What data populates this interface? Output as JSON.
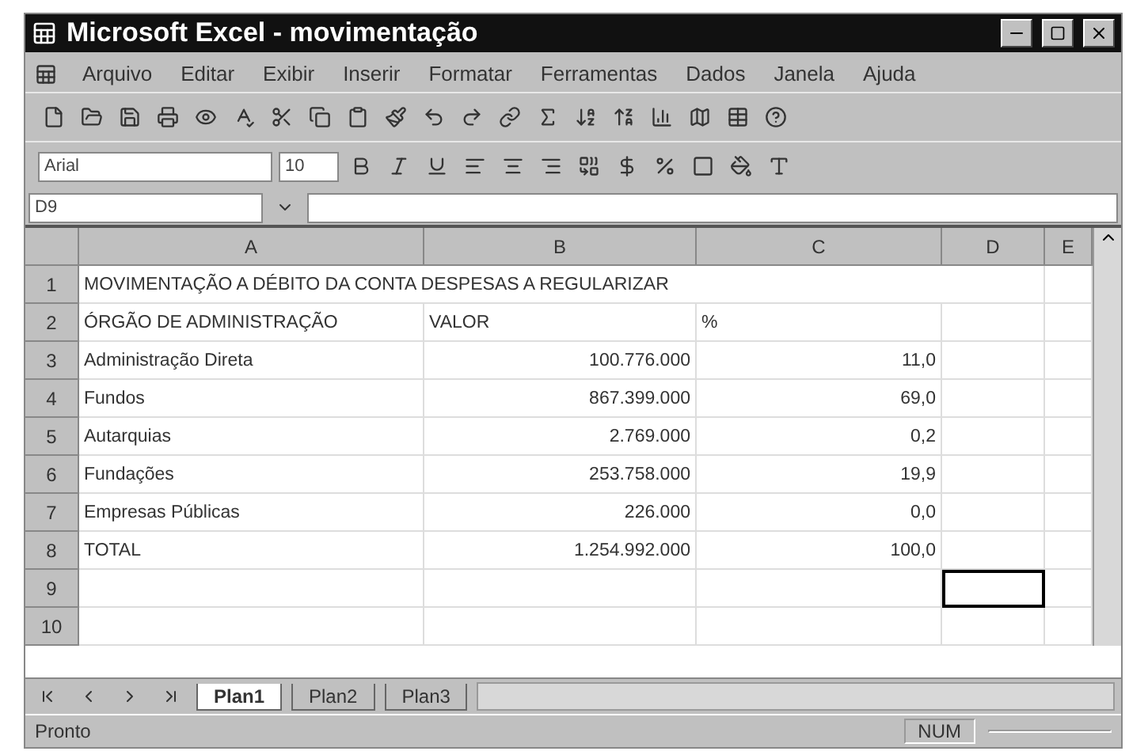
{
  "window": {
    "title": "Microsoft Excel - movimentação"
  },
  "menu": [
    "Arquivo",
    "Editar",
    "Exibir",
    "Inserir",
    "Formatar",
    "Ferramentas",
    "Dados",
    "Janela",
    "Ajuda"
  ],
  "format_toolbar": {
    "font": "Arial",
    "size": "10"
  },
  "formula_bar": {
    "name_box": "D9"
  },
  "columns": [
    "A",
    "B",
    "C",
    "D",
    "E"
  ],
  "rows": [
    {
      "number": "1",
      "cells": [
        {
          "text": "MOVIMENTAÇÃO A DÉBITO DA CONTA DESPESAS A REGULARIZAR",
          "selected": false
        },
        {
          "selected": false
        },
        {
          "selected": false
        },
        {
          "selected": false
        },
        {
          "selected": false
        }
      ]
    },
    {
      "number": "2",
      "cells": [
        {
          "text": "ÓRGÃO DE ADMINISTRAÇÃO",
          "selected": false
        },
        {
          "text": "VALOR",
          "selected": false
        },
        {
          "text": "%",
          "selected": false
        },
        {
          "selected": false
        },
        {
          "selected": false
        }
      ]
    },
    {
      "number": "3",
      "cells": [
        {
          "text": "Administração Direta",
          "selected": false
        },
        {
          "text": "100.776.000",
          "selected": false
        },
        {
          "text": "11,0",
          "selected": false
        },
        {
          "selected": false
        },
        {
          "selected": false
        }
      ]
    },
    {
      "number": "4",
      "cells": [
        {
          "text": "Fundos",
          "selected": false
        },
        {
          "text": "867.399.000",
          "selected": false
        },
        {
          "text": "69,0",
          "selected": false
        },
        {
          "selected": false
        },
        {
          "selected": false
        }
      ]
    },
    {
      "number": "5",
      "cells": [
        {
          "text": "Autarquias",
          "selected": false
        },
        {
          "text": "2.769.000",
          "selected": false
        },
        {
          "text": "0,2",
          "selected": false
        },
        {
          "selected": false
        },
        {
          "selected": false
        }
      ]
    },
    {
      "number": "6",
      "cells": [
        {
          "text": "Fundações",
          "selected": false
        },
        {
          "text": "253.758.000",
          "selected": false
        },
        {
          "text": "19,9",
          "selected": false
        },
        {
          "selected": false
        },
        {
          "selected": false
        }
      ]
    },
    {
      "number": "7",
      "cells": [
        {
          "text": "Empresas Públicas",
          "selected": false
        },
        {
          "text": "226.000",
          "selected": false
        },
        {
          "text": "0,0",
          "selected": false
        },
        {
          "selected": false
        },
        {
          "selected": false
        }
      ]
    },
    {
      "number": "8",
      "cells": [
        {
          "text": "TOTAL",
          "selected": false
        },
        {
          "text": "1.254.992.000",
          "selected": false
        },
        {
          "text": "100,0",
          "selected": false
        },
        {
          "selected": false
        },
        {
          "selected": false
        }
      ]
    },
    {
      "number": "9",
      "cells": [
        {
          "selected": false
        },
        {
          "selected": false
        },
        {
          "selected": false
        },
        {
          "selected": true
        },
        {
          "selected": false
        }
      ]
    },
    {
      "number": "10",
      "cells": [
        {
          "selected": false
        },
        {
          "selected": false
        },
        {
          "selected": false
        },
        {
          "selected": false
        },
        {
          "selected": false
        }
      ]
    }
  ],
  "sheet_tabs": [
    {
      "label": "Plan1",
      "selected": true
    },
    {
      "label": "Plan2",
      "selected": false
    },
    {
      "label": "Plan3",
      "selected": false
    }
  ],
  "status_bar": {
    "status": "Pronto",
    "indicator": "NUM"
  }
}
